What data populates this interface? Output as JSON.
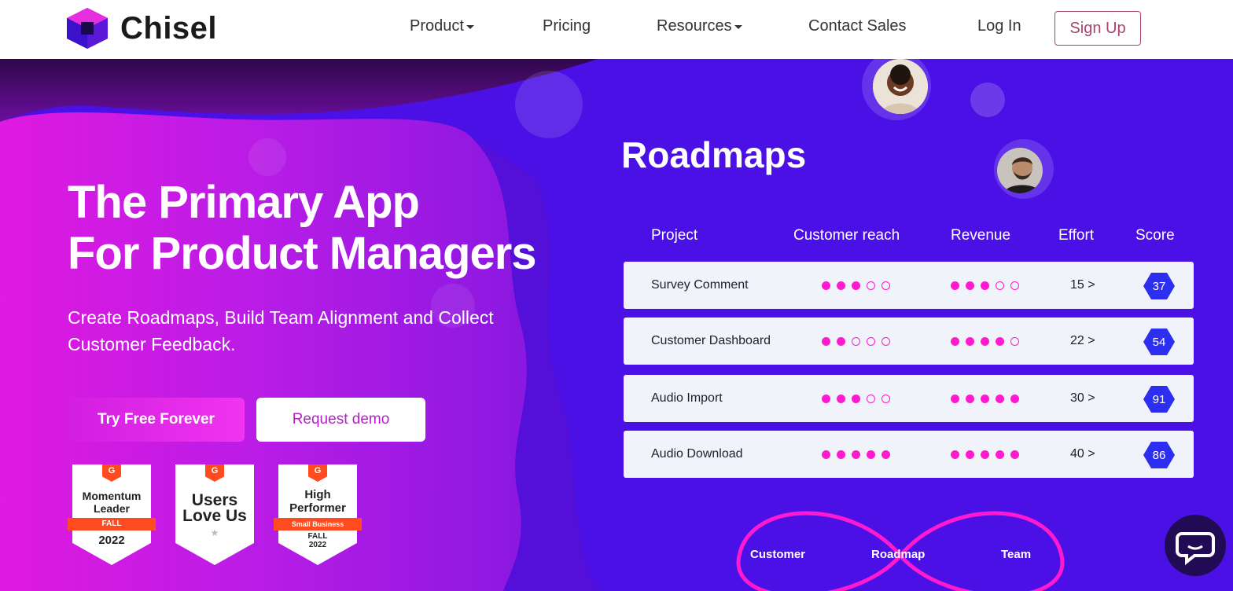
{
  "brand": {
    "name": "Chisel"
  },
  "nav": {
    "items": [
      {
        "label": "Product",
        "dropdown": true
      },
      {
        "label": "Pricing",
        "dropdown": false
      },
      {
        "label": "Resources",
        "dropdown": true
      },
      {
        "label": "Contact Sales",
        "dropdown": false
      },
      {
        "label": "Log In",
        "dropdown": false
      }
    ],
    "signup_label": "Sign Up"
  },
  "hero": {
    "title_line1": "The Primary App",
    "title_line2": "For Product Managers",
    "subtitle": "Create Roadmaps, Build Team Alignment and Collect Customer Feedback.",
    "primary_cta": "Try Free Forever",
    "secondary_cta": "Request demo"
  },
  "badges": [
    {
      "line1": "Momentum",
      "line2": "Leader",
      "ribbon": "FALL",
      "year": "2022"
    },
    {
      "line1": "Users",
      "line2": "Love Us",
      "ribbon": "",
      "year": ""
    },
    {
      "line1": "High",
      "line2": "Performer",
      "ribbon": "Small Business",
      "season": "FALL",
      "year": "2022"
    }
  ],
  "roadmap": {
    "title": "Roadmaps",
    "columns": [
      "Project",
      "Customer reach",
      "Revenue",
      "Effort",
      "Score"
    ],
    "rows": [
      {
        "project": "Survey Comment",
        "reach": 3,
        "revenue": 3,
        "effort": "15 >",
        "score": "37"
      },
      {
        "project": "Customer Dashboard",
        "reach": 2,
        "revenue": 4,
        "effort": "22 >",
        "score": "54"
      },
      {
        "project": "Audio Import",
        "reach": 3,
        "revenue": 5,
        "effort": "30 >",
        "score": "91"
      },
      {
        "project": "Audio Download",
        "reach": 5,
        "revenue": 5,
        "effort": "40 >",
        "score": "86"
      }
    ],
    "max_dots": 5
  },
  "loop": {
    "left": "Customer",
    "center": "Roadmap",
    "right": "Team"
  },
  "colors": {
    "accent": "#ff1ad0",
    "score_bg": "#2d2ff0",
    "signup_border": "#a8416e"
  }
}
